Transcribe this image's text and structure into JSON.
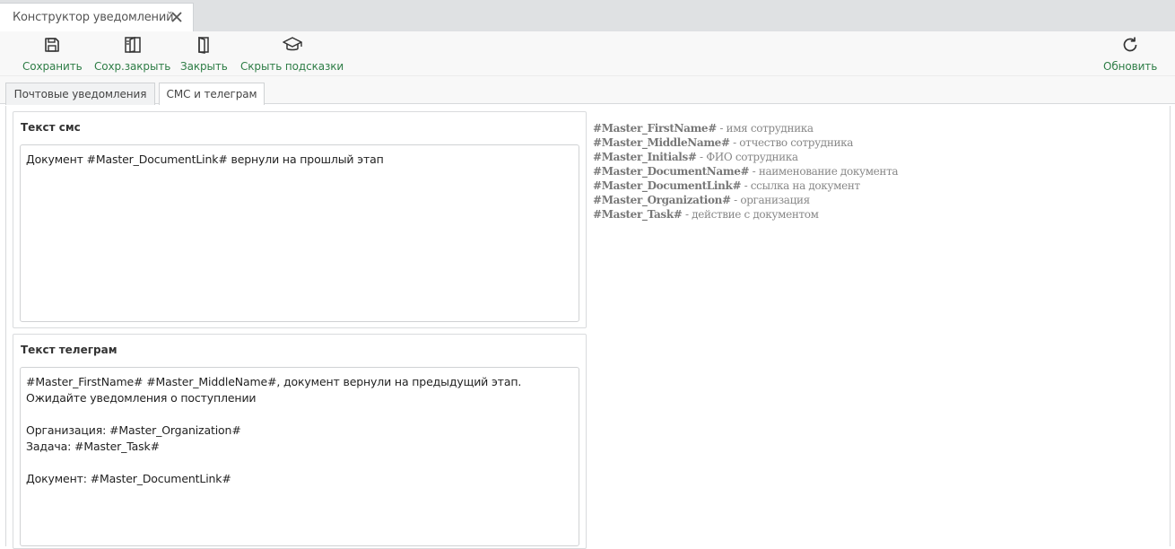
{
  "document_tab": {
    "title": "Конструктор уведомлений",
    "close_icon": "close-icon"
  },
  "toolbar": {
    "save_label": "Сохранить",
    "save_close_label": "Сохр.закрыть",
    "close_label": "Закрыть",
    "hide_hints_label": "Скрыть подсказки",
    "refresh_label": "Обновить",
    "accent_color": "#2e7d46"
  },
  "tabs": [
    {
      "label": "Почтовые уведомления",
      "active": false
    },
    {
      "label": "СМС и телеграм",
      "active": true
    }
  ],
  "sms": {
    "title": "Текст смс",
    "text": "Документ #Master_DocumentLink# вернули на прошлый этап"
  },
  "telegram": {
    "title": "Текст телеграм",
    "text": "#Master_FirstName# #Master_MiddleName#, документ вернули на предыдущий этап. Ожидайте уведомления о поступлении\n\nОрганизация: #Master_Organization#\nЗадача: #Master_Task#\n\nДокумент: #Master_DocumentLink#"
  },
  "hints": [
    {
      "key": "#Master_FirstName#",
      "desc": " - имя сотрудника"
    },
    {
      "key": "#Master_MiddleName#",
      "desc": " - отчество сотрудника"
    },
    {
      "key": "#Master_Initials#",
      "desc": " - ФИО сотрудника"
    },
    {
      "key": "#Master_DocumentName#",
      "desc": " - наименование документа"
    },
    {
      "key": "#Master_DocumentLink#",
      "desc": " - ссылка на документ"
    },
    {
      "key": "#Master_Organization#",
      "desc": " - организация"
    },
    {
      "key": "#Master_Task#",
      "desc": " - действие с документом"
    }
  ]
}
